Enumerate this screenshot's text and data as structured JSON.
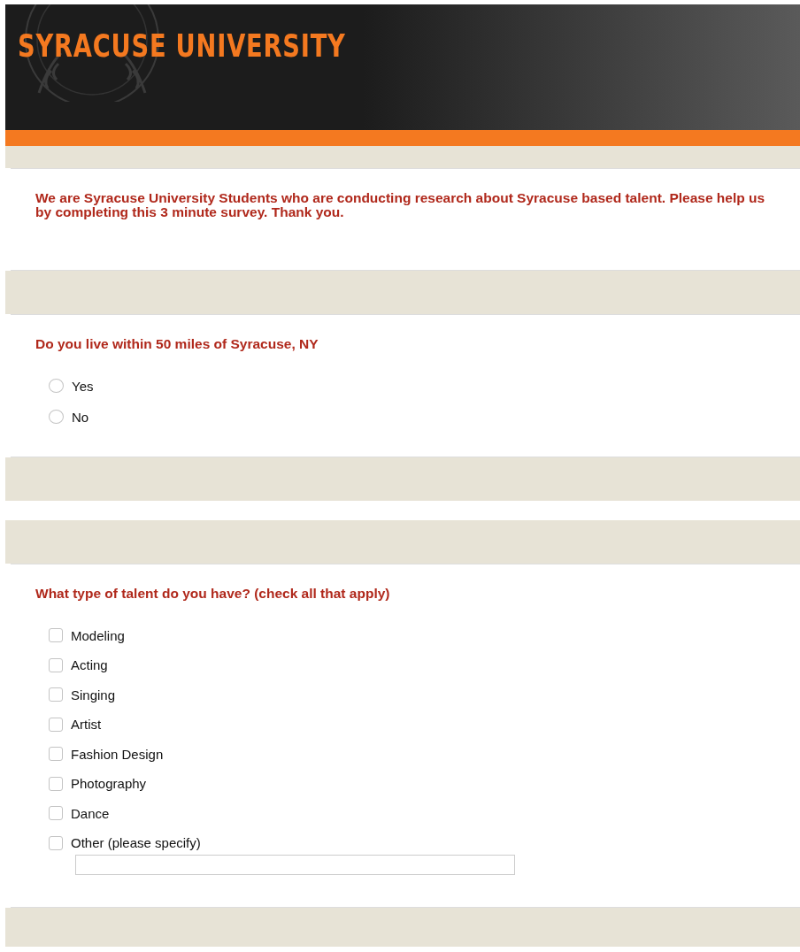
{
  "header": {
    "title": "SYRACUSE UNIVERSITY"
  },
  "intro": {
    "text": "We are Syracuse University Students who are conducting research about Syracuse based talent. Please help us by completing this 3 minute survey. Thank you."
  },
  "questions": [
    {
      "kind": "radio",
      "title": "Do you live within 50 miles of Syracuse, NY",
      "options": [
        {
          "label": "Yes",
          "selected": false
        },
        {
          "label": "No",
          "selected": false
        }
      ]
    },
    {
      "kind": "checkbox",
      "title": "What type of talent do you have? (check all that apply)",
      "options": [
        {
          "label": "Modeling",
          "checked": false
        },
        {
          "label": "Acting",
          "checked": false
        },
        {
          "label": "Singing",
          "checked": false
        },
        {
          "label": "Artist",
          "checked": false
        },
        {
          "label": "Fashion Design",
          "checked": false
        },
        {
          "label": "Photography",
          "checked": false
        },
        {
          "label": "Dance",
          "checked": false
        },
        {
          "label": "Other (please specify)",
          "checked": false,
          "has_text_field": true
        }
      ]
    }
  ]
}
